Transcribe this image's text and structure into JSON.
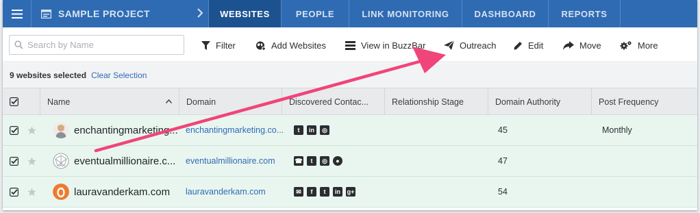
{
  "nav": {
    "project": "SAMPLE PROJECT",
    "tabs": [
      "WEBSITES",
      "PEOPLE",
      "LINK MONITORING",
      "DASHBOARD",
      "REPORTS"
    ],
    "active_tab": "WEBSITES"
  },
  "toolbar": {
    "search_placeholder": "Search by Name",
    "filter": "Filter",
    "add_websites": "Add Websites",
    "view_buzzbar": "View in BuzzBar",
    "outreach": "Outreach",
    "edit": "Edit",
    "move": "Move",
    "more": "More"
  },
  "selection": {
    "count_text": "9 websites selected",
    "clear": "Clear Selection"
  },
  "table": {
    "columns": [
      "Name",
      "Domain",
      "Discovered Contac...",
      "Relationship Stage",
      "Domain Authority",
      "Post Frequency"
    ],
    "rows": [
      {
        "name": "enchantingmarketing...",
        "domain": "enchantingmarketing.co...",
        "contacts": [
          "twitter",
          "linkedin",
          "instagram"
        ],
        "relationship": "",
        "authority": "45",
        "frequency": "Monthly",
        "avatar": "person-photo"
      },
      {
        "name": "eventualmillionaire.c...",
        "domain": "eventualmillionaire.com",
        "contacts": [
          "phone",
          "twitter",
          "instagram",
          "globe"
        ],
        "relationship": "",
        "authority": "47",
        "frequency": "",
        "avatar": "globe-logo"
      },
      {
        "name": "lauravanderkam.com",
        "domain": "lauravanderkam.com",
        "contacts": [
          "email",
          "facebook",
          "twitter",
          "linkedin",
          "google-plus"
        ],
        "relationship": "",
        "authority": "54",
        "frequency": "",
        "avatar": "orange-o-logo"
      }
    ]
  },
  "colors": {
    "nav_bg": "#2f6bb3",
    "nav_active": "#1d5290",
    "row_bg": "#e9f6f0",
    "link": "#2f6bb3",
    "annotation_arrow": "#f0457a"
  }
}
